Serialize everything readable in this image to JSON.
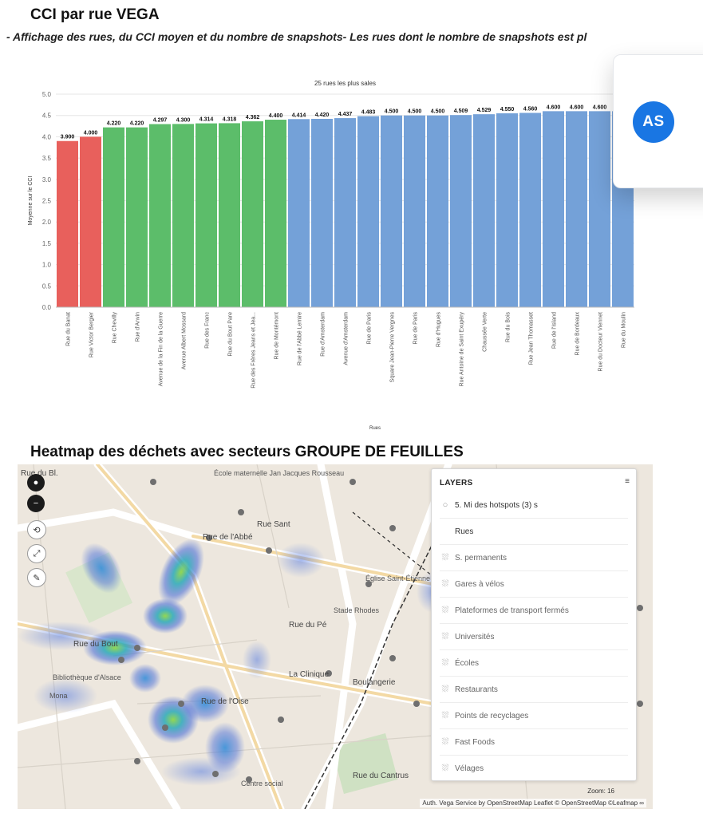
{
  "header": {
    "title": "CCI par rue VEGA",
    "subtitle": "- Affichage des rues, du CCI moyen et du nombre de snapshots- Les rues dont le nombre de snapshots est pl"
  },
  "profile": {
    "initials": "AS"
  },
  "chart_data": {
    "type": "bar",
    "title": "25 rues les plus sales",
    "xlabel": "Rues",
    "ylabel": "Moyenne sur le CCI",
    "ylim": [
      0,
      5
    ],
    "yticks": [
      "0.0",
      "0.5",
      "1.0",
      "1.5",
      "2.0",
      "2.5",
      "3.0",
      "3.5",
      "4.0",
      "4.5",
      "5.0"
    ],
    "grid": true,
    "categories": [
      "Rue du Banat",
      "Rue Victor Bergier",
      "Rue Chevilly",
      "Rue d'Anvin",
      "Avenue de la Fin de la Guerre",
      "Avenue Albert Mossard",
      "Rue des Franc",
      "Rue du Bout Pare",
      "Rue des Frères Jeans et Jea...",
      "Rue de Montémont",
      "Rue de l'Abbé Lemire",
      "Rue d'Amsterdam",
      "Avenue d'Amsterdam",
      "Rue de Paris",
      "Square Jean-Pierre Vergnes",
      "Rue de Paris",
      "Rue d'Hugues",
      "Rue Antoine de Saint Exupéry",
      "Chaussée Verte",
      "Rue du Bois",
      "Rue Jean Thomasset",
      "Rue de l'Island",
      "Rue de Bordeaux",
      "Rue du Docteur Viennet",
      "Rue du Moulin"
    ],
    "values": [
      3.9,
      4.0,
      4.22,
      4.22,
      4.297,
      4.3,
      4.314,
      4.318,
      4.362,
      4.4,
      4.414,
      4.42,
      4.437,
      4.483,
      4.5,
      4.5,
      4.5,
      4.509,
      4.529,
      4.55,
      4.56,
      4.6,
      4.6,
      4.6,
      4.6
    ],
    "value_labels": [
      "3.900",
      "4.000",
      "4.220",
      "4.220",
      "4.297",
      "4.300",
      "4.314",
      "4.318",
      "4.362",
      "4.400",
      "4.414",
      "4.420",
      "4.437",
      "4.483",
      "4.500",
      "4.500",
      "4.500",
      "4.509",
      "4.529",
      "4.550",
      "4.560",
      "4.600",
      "4.600",
      "4.600",
      ""
    ],
    "bar_colors": [
      "#e8605c",
      "#e8605c",
      "#5cbd6a",
      "#5cbd6a",
      "#5cbd6a",
      "#5cbd6a",
      "#5cbd6a",
      "#5cbd6a",
      "#5cbd6a",
      "#5cbd6a",
      "#74a1d8",
      "#74a1d8",
      "#74a1d8",
      "#74a1d8",
      "#74a1d8",
      "#74a1d8",
      "#74a1d8",
      "#74a1d8",
      "#74a1d8",
      "#74a1d8",
      "#74a1d8",
      "#74a1d8",
      "#74a1d8",
      "#74a1d8",
      "#74a1d8"
    ]
  },
  "heatmap_section": {
    "title": "Heatmap des déchets avec secteurs GROUPE DE FEUILLES"
  },
  "map": {
    "controls": [
      {
        "name": "locate-control",
        "glyph": "●",
        "style": "dark"
      },
      {
        "name": "zoom-out-control",
        "glyph": "−",
        "style": "dark"
      },
      {
        "name": "history-control",
        "glyph": "⟲",
        "style": "light"
      },
      {
        "name": "fullscreen-control",
        "glyph": "⤢",
        "style": "light"
      },
      {
        "name": "measure-control",
        "glyph": "✎",
        "style": "light"
      }
    ],
    "layers_panel": {
      "header": "LAYERS",
      "collapse_glyph": "≡",
      "items": [
        "5. Mi des hotspots (3) s",
        "Rues",
        "S. permanents",
        "Gares à vélos",
        "Plateformes de transport fermés",
        "Universités",
        "Écoles",
        "Restaurants",
        "Points de recyclages",
        "Fast Foods",
        "Vélages"
      ]
    },
    "street_labels": [
      "Rue du Bl.",
      "Rue de l'Abbé",
      "Rue Sant",
      "Rue du Bout",
      "Rue du Pé",
      "Rue de l'Oise",
      "La Clinique",
      "Boulangerie",
      "Rue du Cantrus"
    ],
    "place_labels": [
      "École maternelle Jan Jacques Rousseau",
      "Église Saint-Étienne",
      "Stade Rhodes",
      "Bibliothèque d'Alsace",
      "Centre social",
      "Mona"
    ],
    "attribution": "Auth. Vega Service by OpenStreetMap Leaflet © OpenStreetMap ©Leafmap ∞",
    "scale": "Zoom: 16"
  }
}
